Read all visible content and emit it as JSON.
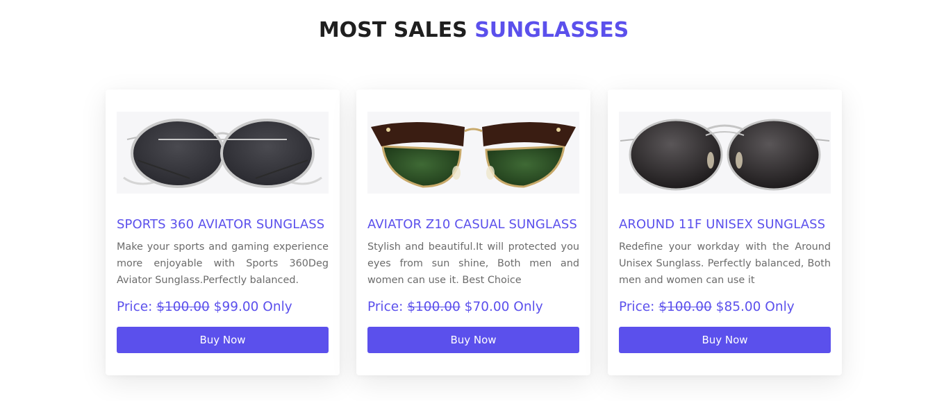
{
  "section": {
    "heading_main": "MOST SALES",
    "heading_accent": "SUNGLASSES"
  },
  "colors": {
    "accent": "#5b50ec",
    "heading": "#1f1f1f",
    "body_text": "#6b6b6b"
  },
  "products": [
    {
      "title": "SPORTS 360 AVIATOR SUNGLASS",
      "description": "Make your sports and gaming experience more enjoyable with Sports 360Deg Aviator Sunglass.Perfectly balanced.",
      "price_label": "Price:",
      "old_price": "$100.00",
      "new_price": "$99.00 Only",
      "button_label": "Buy Now",
      "image_icon": "round-silver-sunglasses-image"
    },
    {
      "title": "AVIATOR Z10 CASUAL SUNGLASS",
      "description": "Stylish and beautiful.It will protected you eyes from sun shine, Both men and women can use it. Best Choice",
      "price_label": "Price:",
      "old_price": "$100.00",
      "new_price": "$70.00 Only",
      "button_label": "Buy Now",
      "image_icon": "tortoise-clubmaster-sunglasses-image"
    },
    {
      "title": "AROUND 11F UNISEX SUNGLASS",
      "description": "Redefine your workday with the Around Unisex Sunglass. Perfectly balanced, Both men and women can use it",
      "price_label": "Price:",
      "old_price": "$100.00",
      "new_price": "$85.00 Only",
      "button_label": "Buy Now",
      "image_icon": "round-dark-sunglasses-image"
    }
  ]
}
